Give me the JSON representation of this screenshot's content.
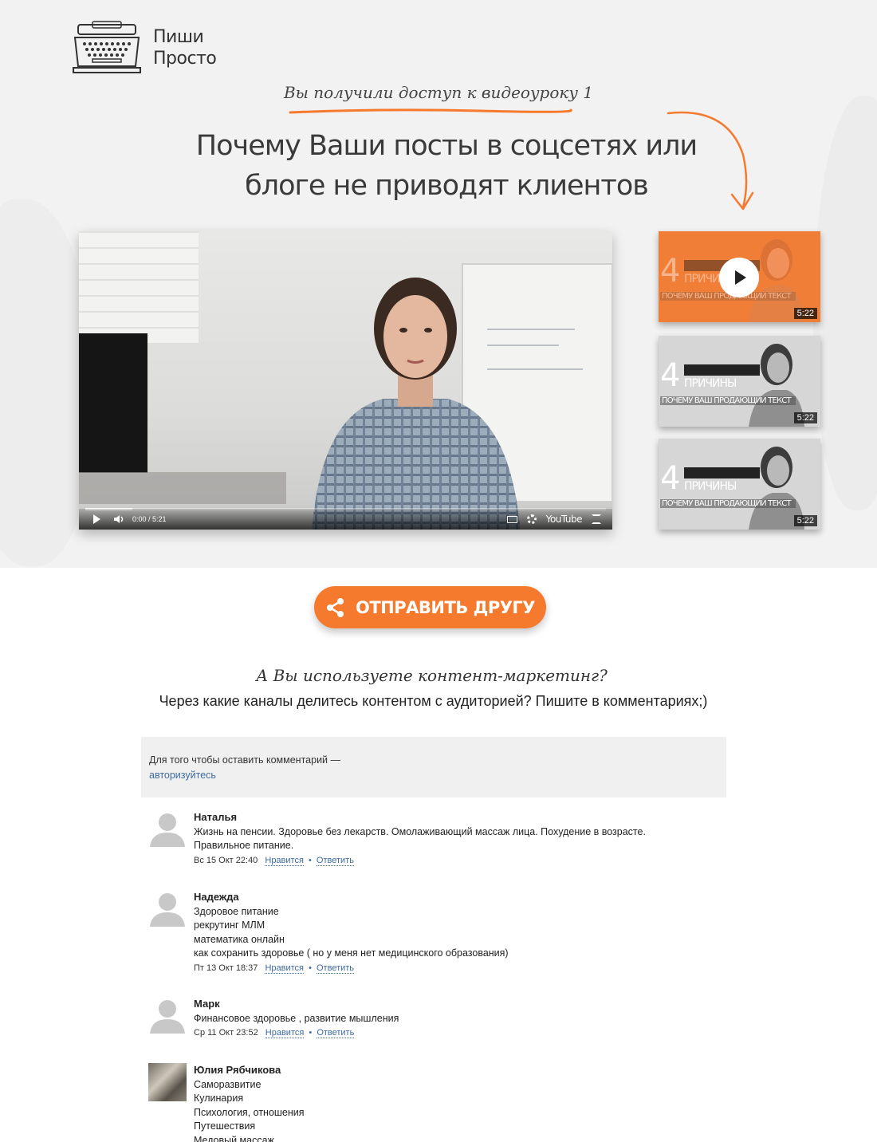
{
  "brand": {
    "line1": "Пиши",
    "line2": "Просто"
  },
  "hero": {
    "access_text": "Вы получили доступ к видеоуроку 1",
    "headline_line1": "Почему Ваши посты в соцсетях или",
    "headline_line2": "блоге не приводят клиентов",
    "accent_color": "#f57a2e"
  },
  "player": {
    "time": "0:00 / 5:21",
    "brand": "YouTube",
    "progress": 0.09
  },
  "thumbnails": [
    {
      "number": "4",
      "title": "ПРИЧИНЫ",
      "subtitle": "ПОЧЕМУ ВАШ ПРОДАЮЩИЙ ТЕКСТ",
      "duration": "5:22",
      "active": true
    },
    {
      "number": "4",
      "title": "ПРИЧИНЫ",
      "subtitle": "ПОЧЕМУ ВАШ ПРОДАЮЩИЙ ТЕКСТ",
      "duration": "5:22",
      "active": false
    },
    {
      "number": "4",
      "title": "ПРИЧИНЫ",
      "subtitle": "ПОЧЕМУ ВАШ ПРОДАЮЩИЙ ТЕКСТ",
      "duration": "5:22",
      "active": false
    }
  ],
  "share": {
    "label": "ОТПРАВИТЬ ДРУГУ",
    "icon": "share-icon"
  },
  "question": {
    "title": "А Вы используете контент-маркетинг?",
    "subtitle": "Через какие каналы делитесь контентом с аудиторией? Пишите в комментариях;)"
  },
  "comments_block": {
    "auth_prompt": "Для того чтобы оставить комментарий —",
    "auth_link": "авторизуйтесь"
  },
  "comments": [
    {
      "name": "Наталья",
      "lines": [
        "Жизнь на пенсии. Здоровье без лекарств. Омолаживающий массаж лица. Похудение в возрасте.",
        "Правильное питание."
      ],
      "date": "Вс 15 Окт 22:40",
      "like": "Нравится",
      "reply": "Ответить"
    },
    {
      "name": "Надежда",
      "lines": [
        "Здоровое питание",
        "рекрутинг МЛМ",
        "математика онлайн",
        "как сохранить здоровье ( но у меня нет медицинского образования)"
      ],
      "date": "Пт 13 Окт 18:37",
      "like": "Нравится",
      "reply": "Ответить"
    },
    {
      "name": "Марк",
      "lines": [
        "Финансовое здоровье , развитие мышления"
      ],
      "date": "Ср 11 Окт 23:52",
      "like": "Нравится",
      "reply": "Ответить"
    },
    {
      "name": "Юлия Рябчикова",
      "lines": [
        "Саморазвитие",
        "Кулинария",
        "Психология, отношения",
        "Путешествия",
        "Медовый массаж"
      ]
    }
  ]
}
